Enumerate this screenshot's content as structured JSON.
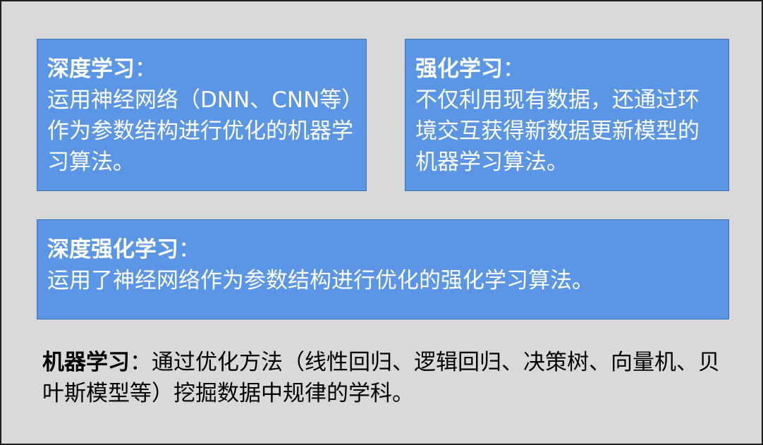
{
  "deep_learning": {
    "title": "深度学习",
    "colon": "：",
    "body": "运用神经网络（DNN、CNN等）作为参数结构进行优化的机器学习算法。"
  },
  "reinforcement_learning": {
    "title": "强化学习",
    "colon": "：",
    "body": "不仅利用现有数据，还通过环境交互获得新数据更新模型的机器学习算法。"
  },
  "deep_reinforcement_learning": {
    "title": "深度强化学习",
    "colon": "：",
    "body": "运用了神经网络作为参数结构进行优化的强化学习算法。"
  },
  "machine_learning": {
    "title": "机器学习",
    "colon": "：",
    "body": "通过优化方法（线性回归、逻辑回归、决策树、向量机、贝叶斯模型等）挖掘数据中规律的学科。"
  },
  "colors": {
    "background": "#d9d9d9",
    "box_fill": "#5b95e6",
    "box_border": "#3d6fb3",
    "box_text": "#ffffff",
    "plain_text": "#000000"
  }
}
